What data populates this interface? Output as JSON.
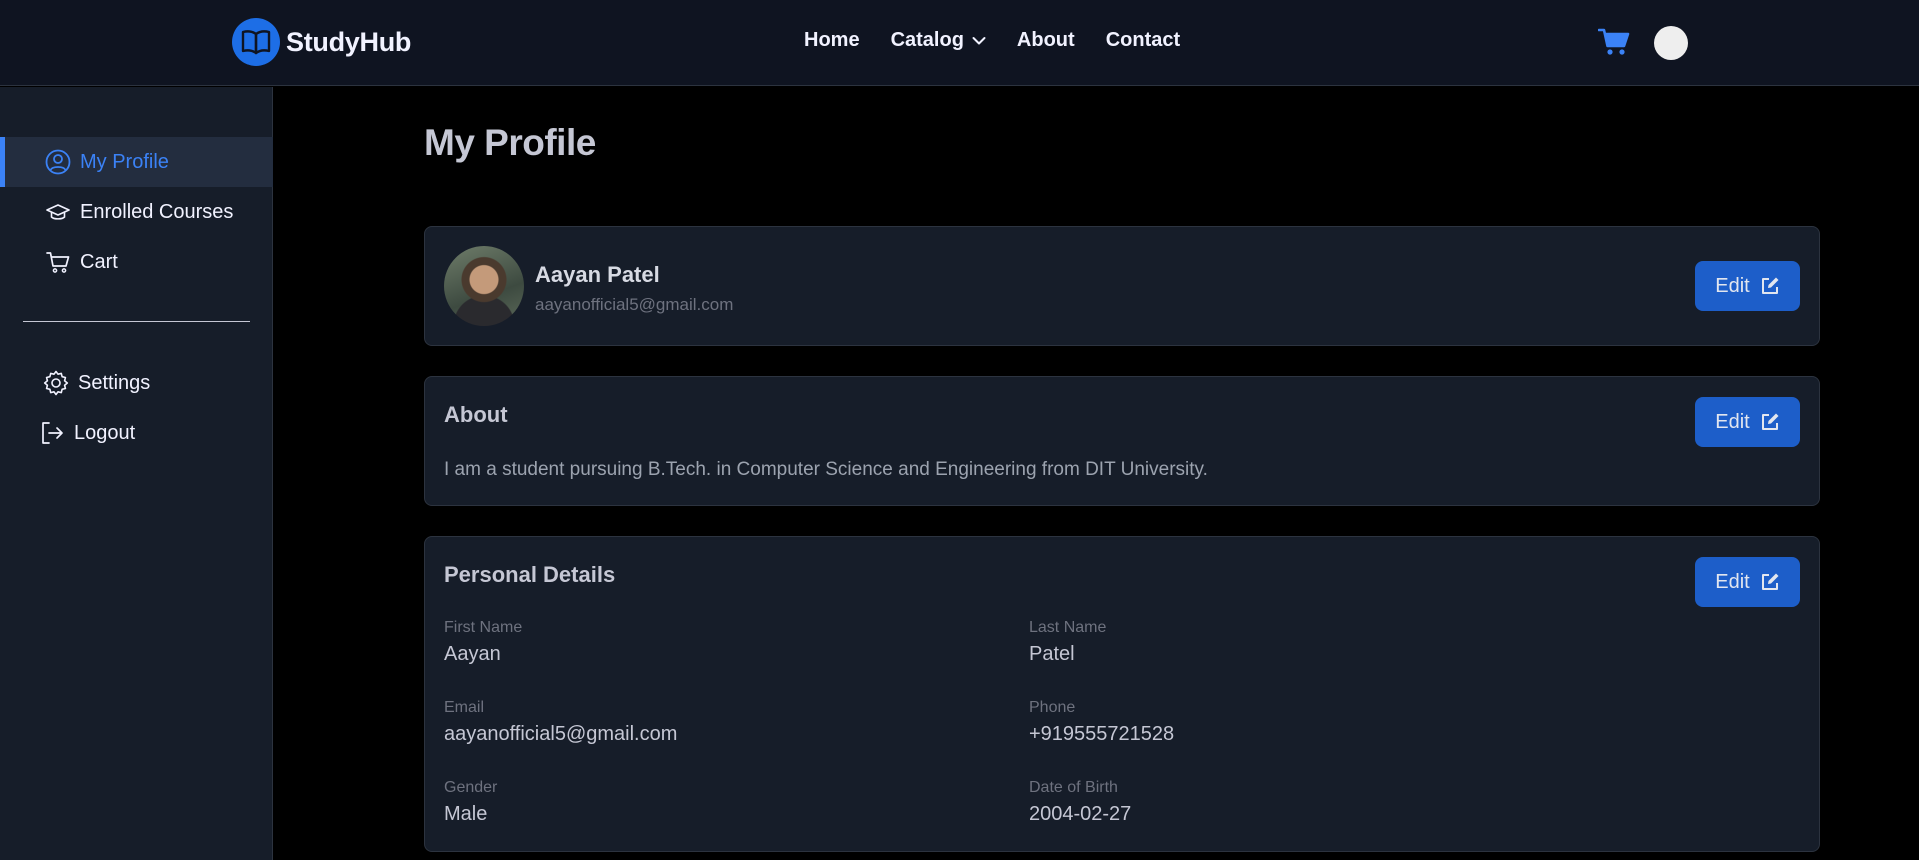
{
  "navbar": {
    "brand": "StudyHub",
    "links": [
      {
        "label": "Home"
      },
      {
        "label": "Catalog"
      },
      {
        "label": "About"
      },
      {
        "label": "Contact"
      }
    ]
  },
  "sidebar": {
    "items": [
      {
        "label": "My Profile",
        "icon": "user-circle-icon",
        "active": true
      },
      {
        "label": "Enrolled Courses",
        "icon": "graduation-cap-icon"
      },
      {
        "label": "Cart",
        "icon": "cart-icon"
      }
    ],
    "bottom_items": [
      {
        "label": "Settings",
        "icon": "gear-icon"
      },
      {
        "label": "Logout",
        "icon": "logout-icon"
      }
    ]
  },
  "page": {
    "title": "My Profile"
  },
  "profile": {
    "name": "Aayan Patel",
    "email": "aayanofficial5@gmail.com",
    "edit_label": "Edit"
  },
  "about": {
    "heading": "About",
    "text": "I am a student pursuing B.Tech. in Computer Science and Engineering from DIT University.",
    "edit_label": "Edit"
  },
  "personal": {
    "heading": "Personal Details",
    "edit_label": "Edit",
    "fields": [
      {
        "label": "First Name",
        "value": "Aayan"
      },
      {
        "label": "Last Name",
        "value": "Patel"
      },
      {
        "label": "Email",
        "value": "aayanofficial5@gmail.com"
      },
      {
        "label": "Phone",
        "value": "+919555721528"
      },
      {
        "label": "Gender",
        "value": "Male"
      },
      {
        "label": "Date of Birth",
        "value": "2004-02-27"
      }
    ]
  },
  "colors": {
    "accent": "#3b82f6",
    "button": "#1d5ec9",
    "navbar_bg": "#0f1421",
    "card_bg": "#161d29"
  }
}
